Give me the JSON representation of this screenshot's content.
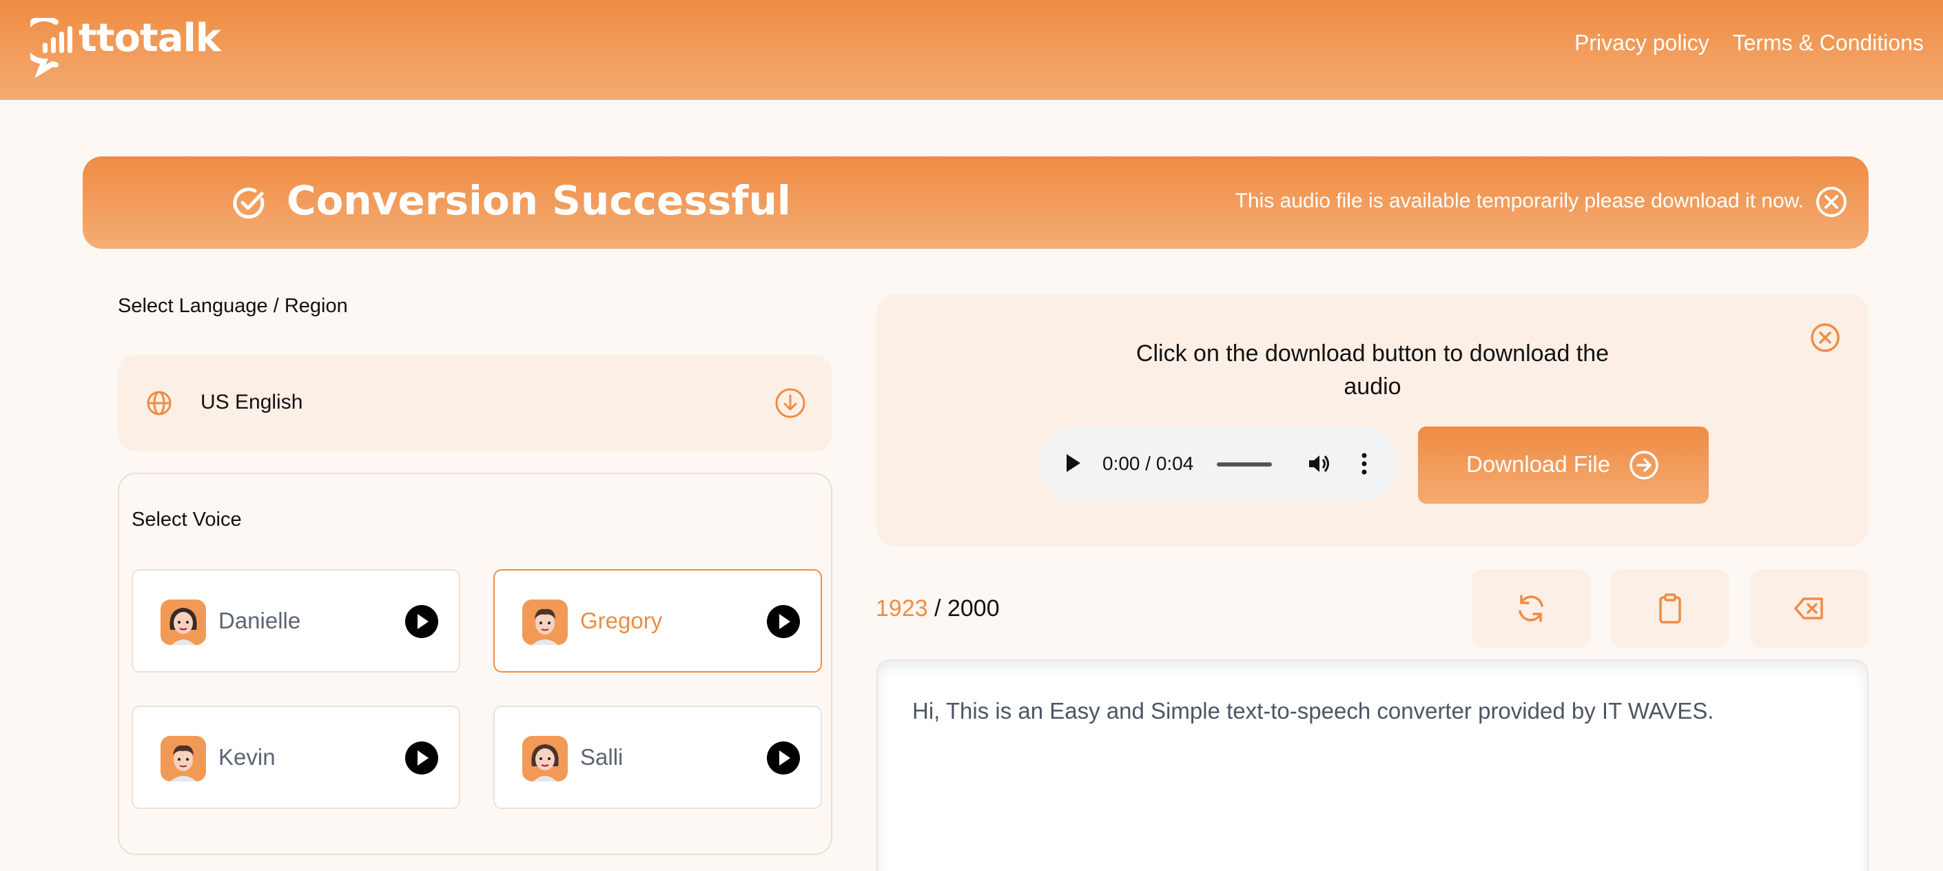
{
  "header": {
    "brand": "ttotalk",
    "nav": [
      "Privacy policy",
      "Terms & Conditions"
    ]
  },
  "banner": {
    "title": "Conversion Successful",
    "note": "This audio file is available temporarily please download it now."
  },
  "language": {
    "label": "Select Language / Region",
    "selected": "US English"
  },
  "voices": {
    "label": "Select Voice",
    "items": [
      {
        "name": "Danielle",
        "selected": false
      },
      {
        "name": "Gregory",
        "selected": true
      },
      {
        "name": "Kevin",
        "selected": false
      },
      {
        "name": "Salli",
        "selected": false
      }
    ]
  },
  "download": {
    "message": "Click on the download button to download the audio",
    "player_time": "0:00 / 0:04",
    "button_label": "Download File"
  },
  "editor": {
    "char_count": "1923",
    "char_limit": "/ 2000",
    "text": "Hi, This is an Easy and Simple text-to-speech converter provided by IT WAVES."
  },
  "colors": {
    "accent": "#ef8c43",
    "background": "#fdf8f3",
    "panel": "#fcefe6"
  },
  "icons": [
    "chat-bars-logo-icon",
    "check-circle-icon",
    "close-circle-icon",
    "globe-icon",
    "chevron-down-circle-icon",
    "play-icon",
    "volume-icon",
    "more-vertical-icon",
    "arrow-right-circle-icon",
    "refresh-icon",
    "clipboard-icon",
    "backspace-icon"
  ]
}
